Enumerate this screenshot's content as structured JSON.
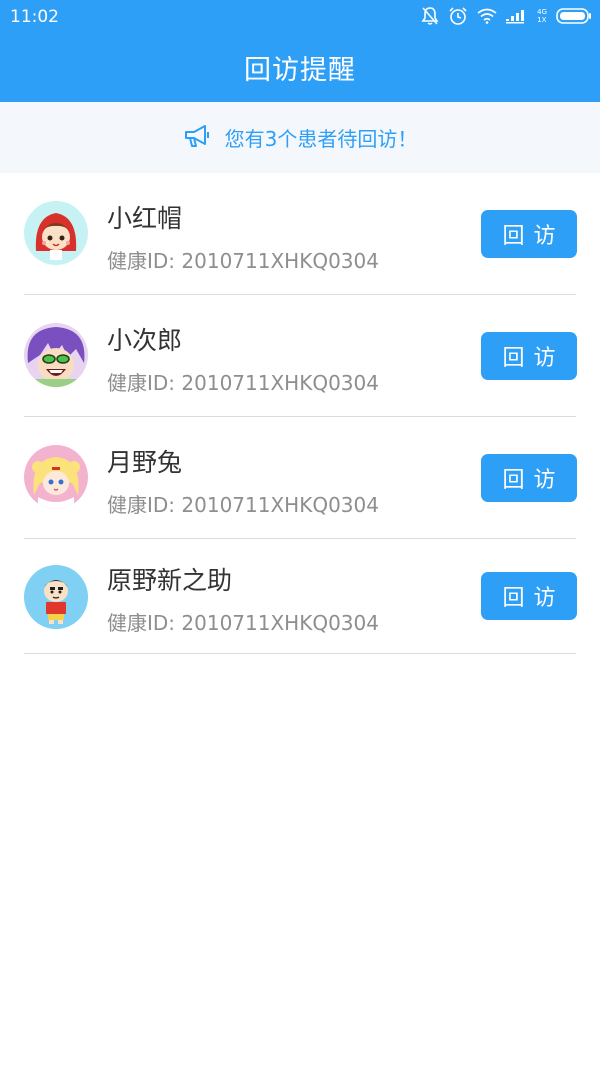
{
  "status_bar": {
    "time": "11:02",
    "network_label_top": "4G",
    "network_label_bottom": "1X"
  },
  "header": {
    "title": "回访提醒"
  },
  "notice": {
    "text": "您有3个患者待回访！",
    "icon": "megaphone-icon"
  },
  "patients": [
    {
      "name": "小红帽",
      "health_id": "健康ID: 2010711XHKQ0304",
      "button": "回访",
      "avatar": "red-riding-hood-avatar"
    },
    {
      "name": "小次郎",
      "health_id": "健康ID: 2010711XHKQ0304",
      "button": "回访",
      "avatar": "kojiro-avatar"
    },
    {
      "name": "月野兔",
      "health_id": "健康ID: 2010711XHKQ0304",
      "button": "回访",
      "avatar": "usagi-avatar"
    },
    {
      "name": "原野新之助",
      "health_id": "健康ID: 2010711XHKQ0304",
      "button": "回访",
      "avatar": "shinnosuke-avatar"
    }
  ],
  "colors": {
    "primary": "#2e9ff7",
    "notice_bg": "#f4f8fc",
    "name": "#333333",
    "id_text": "#8e8e8e"
  }
}
